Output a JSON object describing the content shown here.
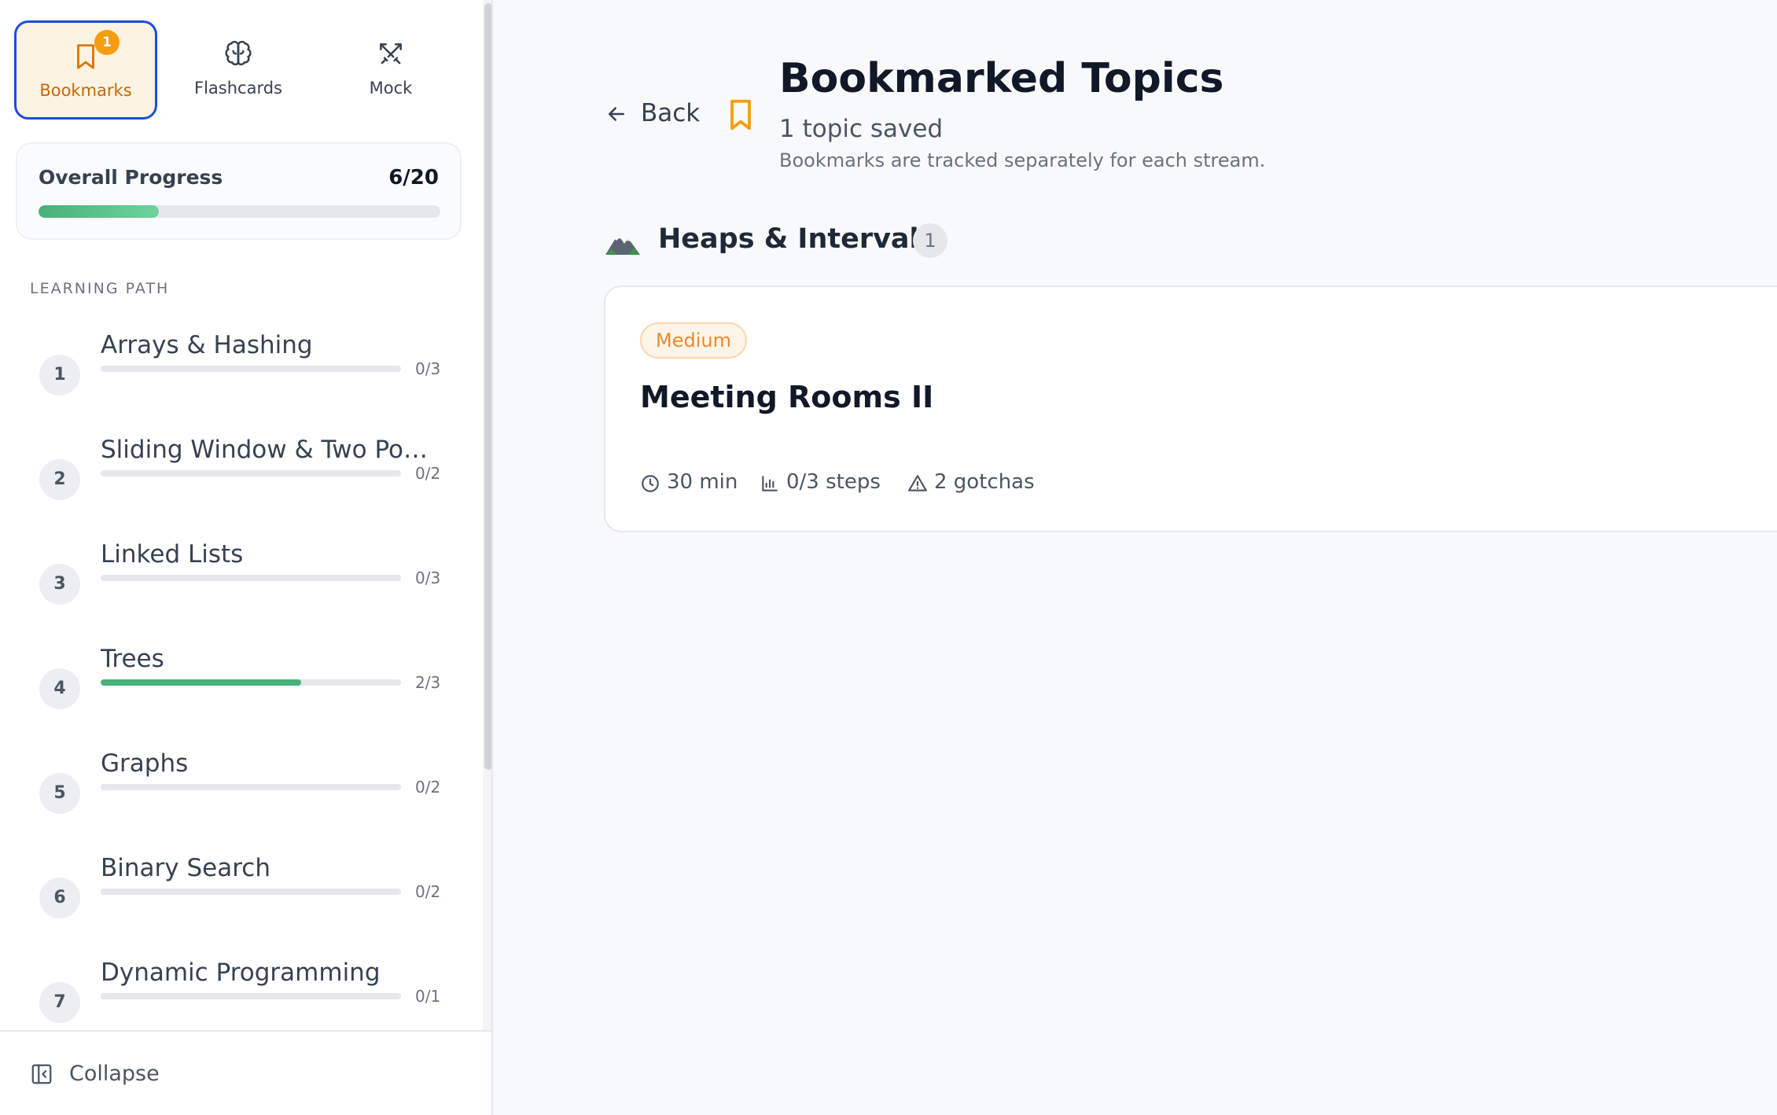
{
  "sidebar": {
    "modes": [
      {
        "label": "Bookmarks",
        "icon": "bookmark-icon",
        "badge": "1",
        "active": true
      },
      {
        "label": "Flashcards",
        "icon": "brain-icon",
        "active": false
      },
      {
        "label": "Mock",
        "icon": "swords-icon",
        "active": false
      }
    ],
    "progress": {
      "title": "Overall Progress",
      "count": "6/20",
      "fraction": 0.3
    },
    "learning_path_title": "LEARNING PATH",
    "path": [
      {
        "num": "1",
        "name": "Arrays & Hashing",
        "count": "0/3",
        "fraction": 0
      },
      {
        "num": "2",
        "name": "Sliding Window & Two Point...",
        "count": "0/2",
        "fraction": 0
      },
      {
        "num": "3",
        "name": "Linked Lists",
        "count": "0/3",
        "fraction": 0
      },
      {
        "num": "4",
        "name": "Trees",
        "count": "2/3",
        "fraction": 0.667
      },
      {
        "num": "5",
        "name": "Graphs",
        "count": "0/2",
        "fraction": 0
      },
      {
        "num": "6",
        "name": "Binary Search",
        "count": "0/2",
        "fraction": 0
      },
      {
        "num": "7",
        "name": "Dynamic Programming",
        "count": "0/1",
        "fraction": 0
      }
    ],
    "collapse_label": "Collapse"
  },
  "main": {
    "back_label": "Back",
    "title": "Bookmarked Topics",
    "subtitle": "1 topic saved",
    "note": "Bookmarks are tracked separately for each stream.",
    "section": {
      "icon": "mountain-icon",
      "title": "Heaps & Intervals",
      "count": "1"
    },
    "topic": {
      "difficulty": "Medium",
      "title": "Meeting Rooms II",
      "time": "30 min",
      "steps": "0/3 steps",
      "gotchas": "2 gotchas"
    }
  },
  "colors": {
    "accent": "#f59e0b",
    "progress": "#4ab07a",
    "active_border": "#1d4ed8",
    "medium": "#ea8a2e"
  }
}
